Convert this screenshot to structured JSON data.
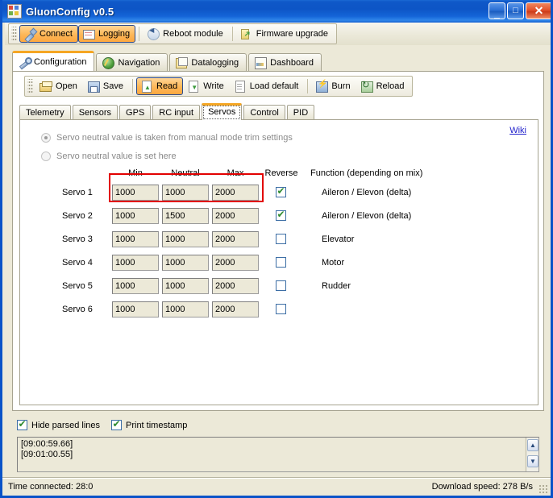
{
  "window": {
    "title": "GluonConfig v0.5",
    "icon": "app-icon",
    "buttons": {
      "minimize": "_",
      "maximize": "□",
      "close": "✕"
    }
  },
  "main_toolbar": {
    "items": [
      {
        "label": "Connect",
        "icon": "connect-icon",
        "checked": true
      },
      {
        "label": "Logging",
        "icon": "logging-icon",
        "checked": true
      },
      {
        "label": "Reboot module",
        "icon": "reboot-icon",
        "checked": false
      },
      {
        "label": "Firmware upgrade",
        "icon": "firmware-upgrade-icon",
        "checked": false
      }
    ]
  },
  "tabs": {
    "items": [
      {
        "label": "Configuration",
        "icon": "wrench-icon",
        "active": true
      },
      {
        "label": "Navigation",
        "icon": "globe-icon",
        "active": false
      },
      {
        "label": "Datalogging",
        "icon": "datalog-icon",
        "active": false
      },
      {
        "label": "Dashboard",
        "icon": "dashboard-icon",
        "active": false
      }
    ]
  },
  "config_toolbar": {
    "items": [
      {
        "label": "Open",
        "icon": "open-folder-icon",
        "checked": false
      },
      {
        "label": "Save",
        "icon": "save-disk-icon",
        "checked": false
      },
      {
        "label": "Read",
        "icon": "read-document-icon",
        "checked": true
      },
      {
        "label": "Write",
        "icon": "write-document-icon",
        "checked": false
      },
      {
        "label": "Load default",
        "icon": "load-default-icon",
        "checked": false
      },
      {
        "label": "Burn",
        "icon": "burn-icon",
        "checked": false
      },
      {
        "label": "Reload",
        "icon": "reload-icon",
        "checked": false
      }
    ]
  },
  "subtabs": {
    "items": [
      {
        "label": "Telemetry",
        "active": false
      },
      {
        "label": "Sensors",
        "active": false
      },
      {
        "label": "GPS",
        "active": false
      },
      {
        "label": "RC input",
        "active": false
      },
      {
        "label": "Servos",
        "active": true
      },
      {
        "label": "Control",
        "active": false
      },
      {
        "label": "PID",
        "active": false
      }
    ]
  },
  "servos_panel": {
    "wiki_link": "Wiki",
    "radio_options": [
      {
        "label": "Servo neutral value is taken from manual mode trim settings",
        "selected": true
      },
      {
        "label": "Servo neutral value is set here",
        "selected": false
      }
    ],
    "columns": {
      "min": "Min",
      "neutral": "Neutral",
      "max": "Max",
      "reverse": "Reverse",
      "function": "Function (depending on mix)"
    },
    "rows": [
      {
        "name": "Servo 1",
        "min": "1000",
        "neutral": "1000",
        "max": "2000",
        "reverse": true,
        "function": "Aileron / Elevon (delta)"
      },
      {
        "name": "Servo 2",
        "min": "1000",
        "neutral": "1500",
        "max": "2000",
        "reverse": true,
        "function": "Aileron / Elevon (delta)"
      },
      {
        "name": "Servo 3",
        "min": "1000",
        "neutral": "1000",
        "max": "2000",
        "reverse": false,
        "function": "Elevator"
      },
      {
        "name": "Servo 4",
        "min": "1000",
        "neutral": "1000",
        "max": "2000",
        "reverse": false,
        "function": "Motor"
      },
      {
        "name": "Servo 5",
        "min": "1000",
        "neutral": "1000",
        "max": "2000",
        "reverse": false,
        "function": "Rudder"
      },
      {
        "name": "Servo 6",
        "min": "1000",
        "neutral": "1000",
        "max": "2000",
        "reverse": false,
        "function": ""
      }
    ],
    "highlight_color": "#e20000"
  },
  "bottom": {
    "hide_parsed_lines": {
      "label": "Hide parsed lines",
      "checked": true
    },
    "print_timestamp": {
      "label": "Print timestamp",
      "checked": true
    },
    "log_lines": "[09:00:59.66]\n[09:01:00.55]",
    "scroll_up": "▲",
    "scroll_down": "▼"
  },
  "status_bar": {
    "time_connected": "Time connected:  28:0",
    "download_speed": "Download speed:  278 B/s"
  }
}
